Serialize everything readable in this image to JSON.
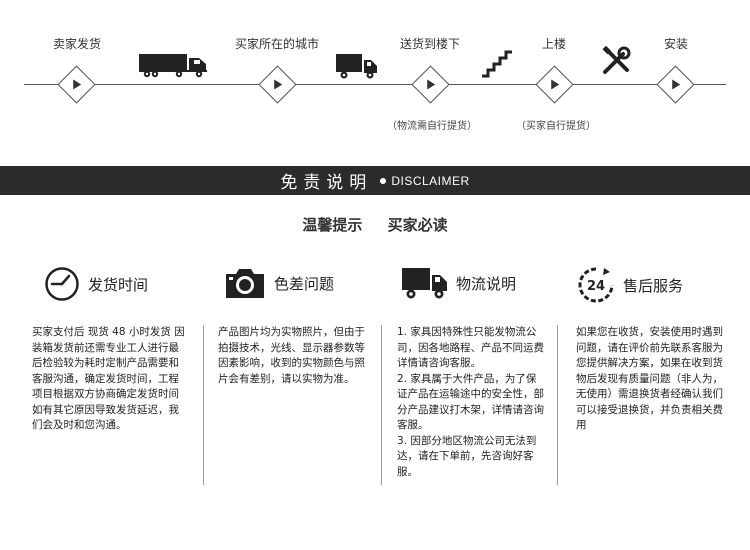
{
  "process": {
    "steps": [
      {
        "label": "卖家发货"
      },
      {
        "label": "买家所在的城市"
      },
      {
        "label": "送货到楼下",
        "note": "（物流需自行提货）"
      },
      {
        "label": "上楼",
        "note": "（买家自行提货）"
      },
      {
        "label": "安装"
      }
    ]
  },
  "banner": {
    "title_cn": "免责说明",
    "title_en": "DISCLAIMER"
  },
  "tips": {
    "left": "温馨提示",
    "right": "买家必读"
  },
  "columns": [
    {
      "icon": "clock-icon",
      "title": "发货时间",
      "text": "买家支付后 现货 48 小时发货 因装箱发货前还需专业工人进行最后检验较为耗时定制产品需要和客服沟通，确定发货时间，工程项目根据双方协商确定发货时间如有其它原因导致发货延迟，我们会及时和您沟通。"
    },
    {
      "icon": "camera-icon",
      "title": "色差问题",
      "text": "产品图片均为实物照片，但由于拍摄技术，光线、显示器参数等因素影响，收到的实物颜色与照片会有差别，请以实物为准。"
    },
    {
      "icon": "truck-icon",
      "title": "物流说明",
      "items": [
        "1. 家具因特殊性只能发物流公司，因各地路程、产品不同运费详情请咨询客服。",
        "2. 家具属于大件产品，为了保证产品在运输途中的安全性，部分产品建议打木架，详情请咨询客服。",
        "3. 因部分地区物流公司无法到达，请在下单前，先咨询好客服。"
      ]
    },
    {
      "icon": "24h-service-icon",
      "icon_text": "24",
      "title": "售后服务",
      "text": "如果您在收货，安装使用时遇到问题，请在评价前先联系客服为您提供解决方案，如果在收到货物后发现有质量问题（非人为，无使用）需退换货者经确认我们可以接受退换货，并负责相关费用"
    }
  ]
}
